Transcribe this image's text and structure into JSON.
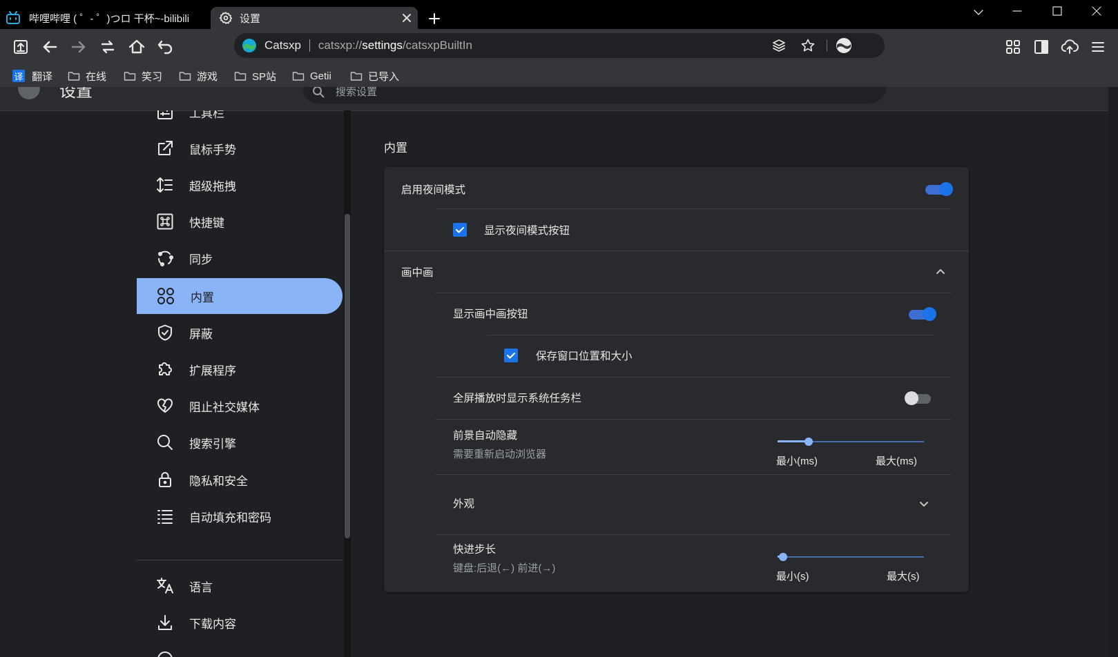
{
  "browser": {
    "tabs": [
      {
        "title": "哔哩哔哩 ( ゜- ゜)つロ 干杯~-bilibili",
        "active": false
      },
      {
        "title": "设置",
        "active": true
      }
    ],
    "omnibox": {
      "site_name": "Catsxp",
      "url_scheme": "catsxp://",
      "url_host": "settings",
      "url_path": "/catsxpBuiltIn"
    },
    "bookmarks": [
      "翻译",
      "在线",
      "笑习",
      "游戏",
      "SP站",
      "Getii",
      "已导入"
    ],
    "translate_badge": "译"
  },
  "settings_header": {
    "title": "设置",
    "search_placeholder": "搜索设置"
  },
  "sidebar": {
    "items": [
      {
        "label": "工具栏",
        "icon": "toolbar-icon"
      },
      {
        "label": "鼠标手势",
        "icon": "mouse-gesture-icon"
      },
      {
        "label": "超级拖拽",
        "icon": "super-drag-icon"
      },
      {
        "label": "快捷键",
        "icon": "command-key-icon"
      },
      {
        "label": "同步",
        "icon": "sync-icon"
      },
      {
        "label": "内置",
        "icon": "builtin-grid-icon",
        "active": true
      },
      {
        "label": "屏蔽",
        "icon": "shield-icon"
      },
      {
        "label": "扩展程序",
        "icon": "puzzle-icon"
      },
      {
        "label": "阻止社交媒体",
        "icon": "broken-heart-icon"
      },
      {
        "label": "搜索引擎",
        "icon": "search-icon"
      },
      {
        "label": "隐私和安全",
        "icon": "lock-icon"
      },
      {
        "label": "自动填充和密码",
        "icon": "list-icon"
      }
    ],
    "items2": [
      {
        "label": "语言",
        "icon": "translate-icon"
      },
      {
        "label": "下载内容",
        "icon": "download-icon"
      }
    ]
  },
  "main": {
    "section_title": "内置",
    "night_mode": {
      "label": "启用夜间模式",
      "enabled": true
    },
    "show_night_button": {
      "label": "显示夜间模式按钮",
      "checked": true
    },
    "pip": {
      "title": "画中画",
      "expanded": true,
      "show_button": {
        "label": "显示画中画按钮",
        "enabled": true
      },
      "save_window": {
        "label": "保存窗口位置和大小",
        "checked": true
      },
      "fullscreen_taskbar": {
        "label": "全屏播放时显示系统任务栏",
        "enabled": false
      },
      "auto_hide": {
        "label": "前景自动隐藏",
        "sub": "需要重新启动浏览器",
        "min_label": "最小(ms)",
        "max_label": "最大(ms)",
        "value_fraction": 0.21
      },
      "appearance": {
        "label": "外观",
        "expanded": false
      },
      "seek_step": {
        "label": "快进步长",
        "sub": "键盘:后退(←) 前进(→)",
        "min_label": "最小(s)",
        "max_label": "最大(s)",
        "value_fraction": 0.04
      }
    }
  }
}
